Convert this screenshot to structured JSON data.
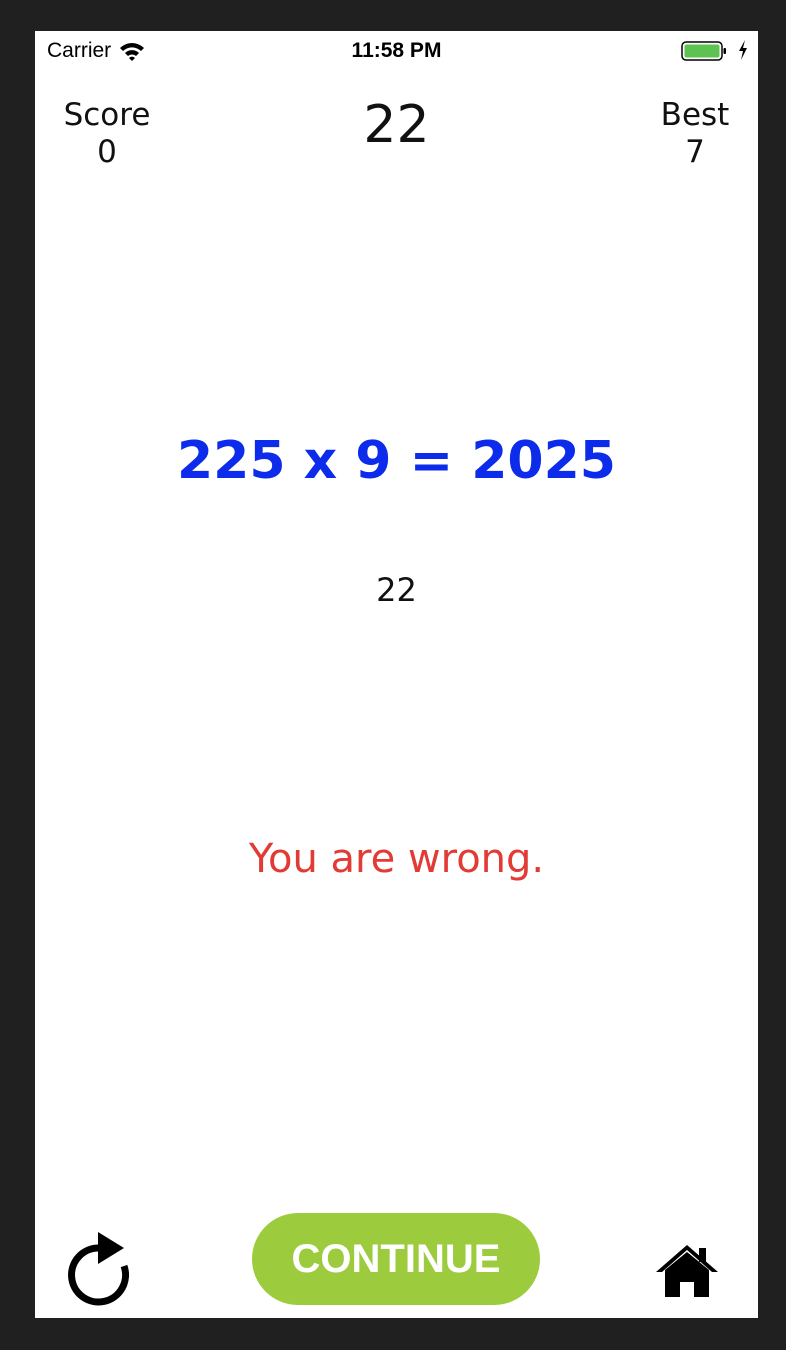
{
  "status_bar": {
    "carrier": "Carrier",
    "time": "11:58 PM",
    "icons": [
      "wifi-icon",
      "battery-icon",
      "charging-bolt-icon"
    ],
    "battery_color": "#5ec252"
  },
  "header": {
    "score_label": "Score",
    "score_value": "0",
    "timer": "22",
    "best_label": "Best",
    "best_value": "7"
  },
  "main": {
    "equation": "225 x 9 = 2025",
    "answer": "22",
    "result_message": "You are wrong."
  },
  "footer": {
    "restart_icon": "restart-icon",
    "continue_label": "CONTINUE",
    "home_icon": "home-icon"
  },
  "colors": {
    "equation": "#0c2bea",
    "result": "#e23b36",
    "continue_button": "#9ccc3d"
  }
}
